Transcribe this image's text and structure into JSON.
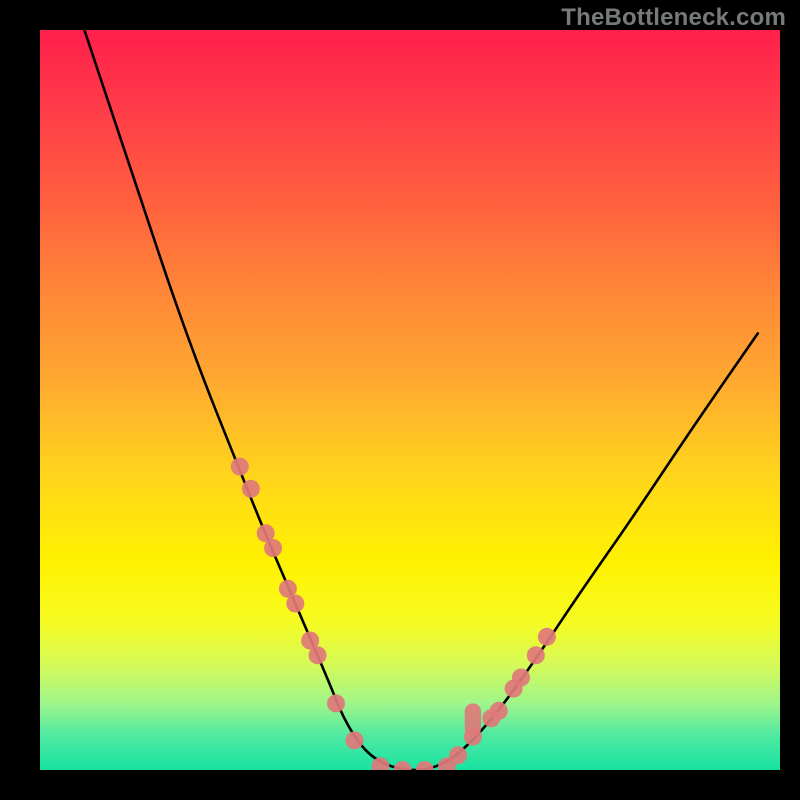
{
  "watermark": "TheBottleneck.com",
  "chart_data": {
    "type": "line",
    "title": "",
    "xlabel": "",
    "ylabel": "",
    "xlim": [
      0,
      100
    ],
    "ylim": [
      0,
      100
    ],
    "legend": false,
    "grid": false,
    "series": [
      {
        "name": "bottleneck-curve",
        "color": "#000000",
        "x": [
          6,
          10,
          14,
          18,
          22,
          26,
          30,
          33,
          36,
          39,
          41,
          43.5,
          46,
          49,
          52,
          55,
          58,
          62,
          67,
          73,
          80,
          88,
          97
        ],
        "values": [
          100,
          88,
          76,
          64,
          53,
          43,
          33,
          26,
          19,
          12,
          7,
          3,
          1,
          0,
          0,
          1,
          3.5,
          8,
          15,
          24,
          34,
          46,
          59
        ]
      }
    ],
    "markers": {
      "name": "highlight-points",
      "color": "#e0787a",
      "radius": 9,
      "x": [
        27,
        28.5,
        30.5,
        31.5,
        33.5,
        34.5,
        36.5,
        37.5,
        40,
        42.5,
        46,
        49,
        52,
        55,
        56.5,
        58.5,
        61,
        62,
        64,
        65,
        67,
        68.5
      ],
      "values": [
        41,
        38,
        32,
        30,
        24.5,
        22.5,
        17.5,
        15.5,
        9,
        4,
        0.5,
        0,
        0,
        0.5,
        2,
        4.5,
        7,
        8,
        11,
        12.5,
        15.5,
        18
      ]
    },
    "smear": {
      "name": "smear-blob",
      "color": "#e0787a",
      "x": 58.5,
      "y_top": 9,
      "y_bottom": 4.5,
      "width_pct": 2.2
    },
    "background_gradient": {
      "stops": [
        {
          "pct": 0,
          "color": "#ff1f4b"
        },
        {
          "pct": 35,
          "color": "#ff8638"
        },
        {
          "pct": 72,
          "color": "#fff200"
        },
        {
          "pct": 100,
          "color": "#16e3a3"
        }
      ]
    }
  }
}
